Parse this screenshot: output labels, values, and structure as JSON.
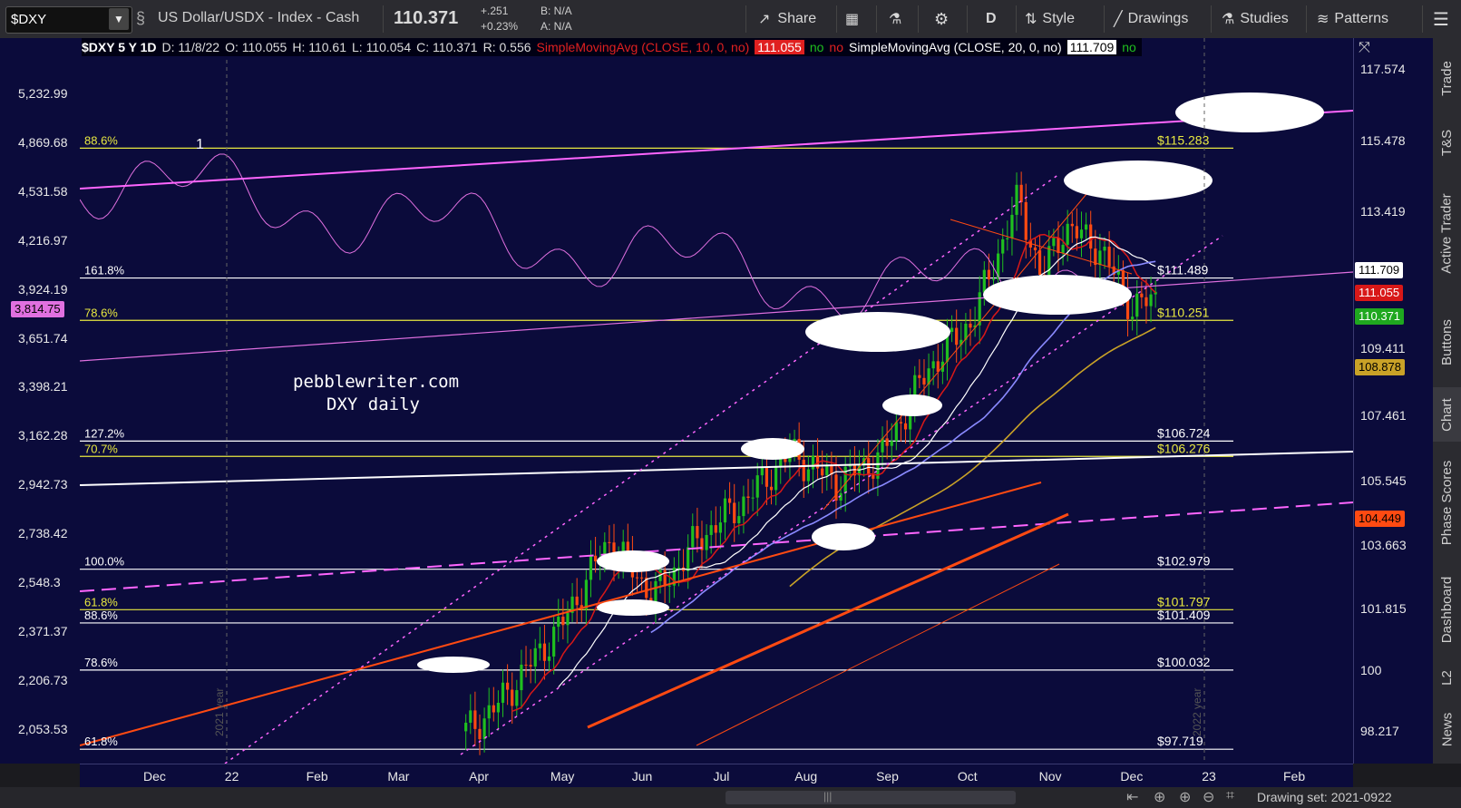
{
  "toolbar": {
    "symbol": "$DXY",
    "instrument_name": "US Dollar/USDX - Index - Cash",
    "last_price": "110.371",
    "change": "+.251",
    "change_pct": "+0.23%",
    "bid": "B: N/A",
    "ask": "A: N/A",
    "share_label": "Share",
    "interval_label": "D",
    "style_label": "Style",
    "drawings_label": "Drawings",
    "studies_label": "Studies",
    "patterns_label": "Patterns"
  },
  "info_line": {
    "title": "$DXY 5 Y 1D",
    "date": "D: 11/8/22",
    "open": "O: 110.055",
    "high": "H: 110.61",
    "low": "L: 110.054",
    "close": "C: 110.371",
    "range": "R: 0.556",
    "sma10_label": "SimpleMovingAvg (CLOSE, 10, 0, no)",
    "sma10_value": "111.055",
    "sma10_flag1": "no",
    "sma10_flag2": "no",
    "sma20_label": "SimpleMovingAvg (CLOSE, 20, 0, no)",
    "sma20_value": "111.709",
    "sma20_flag1": "no"
  },
  "sidebar": {
    "items": [
      "Trade",
      "T&S",
      "Active Trader",
      "Buttons",
      "Chart",
      "Phase Scores",
      "Dashboard",
      "L2",
      "News"
    ]
  },
  "bottom": {
    "drawing_set": "Drawing set: 2021-0922"
  },
  "chart_data": {
    "type": "candlestick",
    "symbol": "$DXY",
    "annotation_text": [
      "pebblewriter.com",
      "DXY daily"
    ],
    "wave_label": "1",
    "x_tick_labels": [
      "Dec",
      "22",
      "Feb",
      "Mar",
      "Apr",
      "May",
      "Jun",
      "Jul",
      "Aug",
      "Sep",
      "Oct",
      "Nov",
      "Dec",
      "23",
      "Feb"
    ],
    "year_labels": [
      "2021 year",
      "2022 year"
    ],
    "right_axis_ticks": [
      117.574,
      115.478,
      113.419,
      109.411,
      107.461,
      105.545,
      103.663,
      101.815,
      100,
      98.217
    ],
    "right_axis_range": [
      97.3,
      118.5
    ],
    "left_axis_ticks": [
      "5,232.99",
      "4,869.68",
      "4,531.58",
      "4,216.97",
      "3,924.19",
      "3,651.74",
      "3,398.21",
      "3,162.28",
      "2,942.73",
      "2,738.42",
      "2,548.3",
      "2,371.37",
      "2,206.73",
      "2,053.53"
    ],
    "left_axis_highlight": "3,814.75",
    "price_tags": [
      {
        "value": "111.709",
        "bg": "#ffffff",
        "fg": "#000000"
      },
      {
        "value": "111.055",
        "bg": "#d81818",
        "fg": "#ffffff"
      },
      {
        "value": "110.371",
        "bg": "#1fa81f",
        "fg": "#ffffff"
      },
      {
        "value": "108.878",
        "bg": "#c9a227",
        "fg": "#000000"
      },
      {
        "value": "104.449",
        "bg": "#ff4a12",
        "fg": "#000000"
      }
    ],
    "fib_levels": [
      {
        "label": "88.6%",
        "price_label": "$115.283",
        "color": "#e8e840"
      },
      {
        "label": "161.8%",
        "price_label": "$111.489",
        "color": "#ffffff"
      },
      {
        "label": "78.6%",
        "price_label": "$110.251",
        "color": "#e8e840"
      },
      {
        "label": "127.2%",
        "price_label": "$106.724",
        "color": "#ffffff"
      },
      {
        "label": "70.7%",
        "price_label": "$106.276",
        "color": "#e8e840"
      },
      {
        "label": "100.0%",
        "price_label": "$102.979",
        "color": "#ffffff"
      },
      {
        "label": "61.8%",
        "price_label": "$101.797",
        "color": "#e8e840"
      },
      {
        "label": "88.6%",
        "price_label": "$101.409",
        "color": "#ffffff"
      },
      {
        "label": "78.6%",
        "price_label": "$100.032",
        "color": "#ffffff"
      },
      {
        "label": "61.8%",
        "price_label": "$97.719",
        "color": "#ffffff"
      }
    ],
    "colors": {
      "background": "#0b0b3b",
      "up_candle": "#1fbf1f",
      "down_candle": "#ff4a12",
      "sma10": "#d81818",
      "sma20": "#ffffff",
      "sma50": "#8a8aff",
      "sma100": "#c9a227",
      "spx_overlay": "#e070e0"
    }
  }
}
